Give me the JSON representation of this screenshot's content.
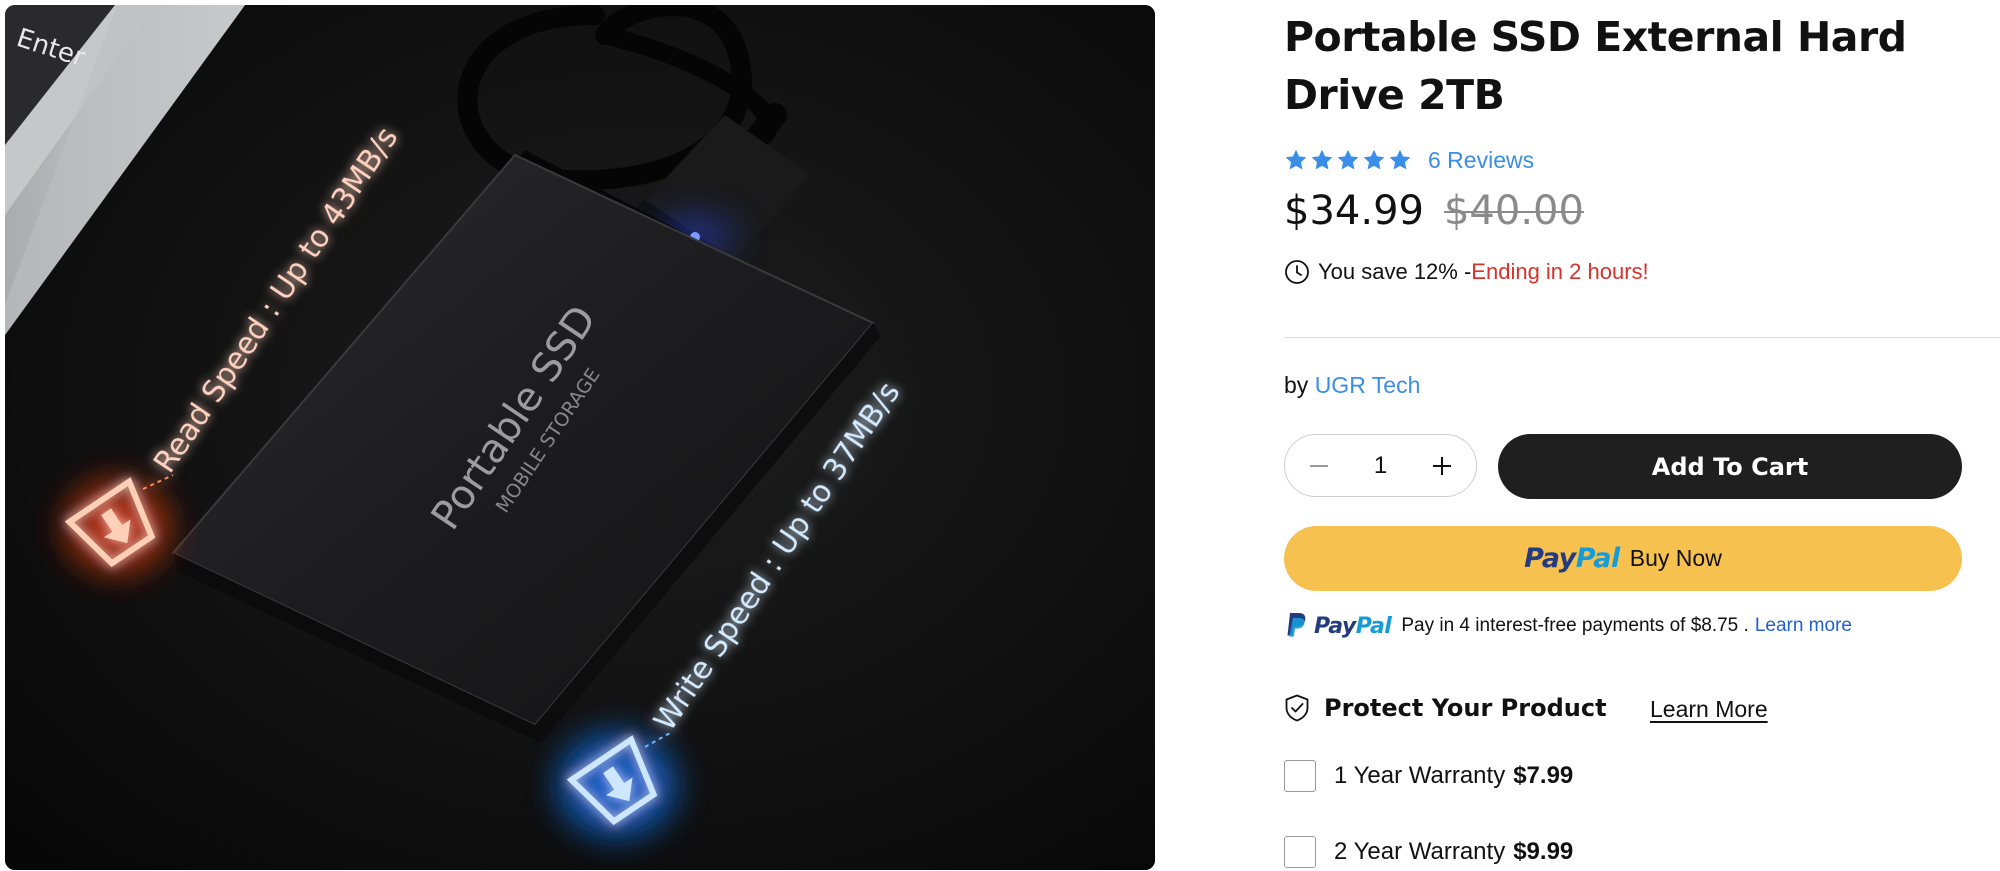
{
  "image": {
    "read_speed": "Read Speed : Up to 43MB/s",
    "write_speed": "Write Speed : Up to 37MB/s",
    "device_label": "Portable SSD",
    "device_sublabel": "MOBILE STORAGE",
    "key_label": "Enter",
    "read_color": "#ff5a2a",
    "write_color": "#4aa8ff"
  },
  "product": {
    "title": "Portable SSD External Hard Drive 2TB",
    "rating": 5,
    "reviews_label": "6 Reviews",
    "price": "$34.99",
    "compare_price": "$40.00",
    "savings_text": "You save 12% - ",
    "urgency_text": "Ending in 2 hours!",
    "vendor_prefix": "by ",
    "vendor": "UGR Tech"
  },
  "purchase": {
    "quantity": "1",
    "add_to_cart": "Add To Cart",
    "paypal_pay": "Pay",
    "paypal_pal": "Pal",
    "buy_now": "Buy Now",
    "paylater_text": "Pay in 4 interest-free payments of $8.75 .",
    "paylater_link": "Learn more"
  },
  "protection": {
    "title": "Protect Your Product",
    "learn_more": "Learn More",
    "options": [
      {
        "label": "1 Year Warranty",
        "price": "$7.99",
        "checked": false
      },
      {
        "label": "2 Year Warranty",
        "price": "$9.99",
        "checked": false
      }
    ]
  },
  "colors": {
    "accent_link": "#3a8ee8",
    "urgent": "#d6322a",
    "cart_button": "#1f1f1f",
    "paypal_button": "#f7c14f"
  },
  "icons": {
    "star": "star-icon",
    "clock": "clock-icon",
    "minus": "minus-icon",
    "plus": "plus-icon",
    "paypal": "paypal-icon",
    "shield": "shield-check-icon"
  }
}
